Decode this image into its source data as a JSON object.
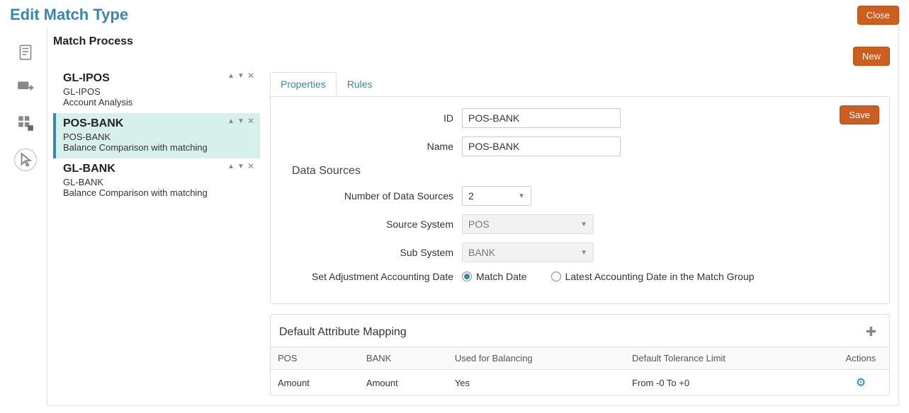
{
  "page_title": "Edit Match Type",
  "close_label": "Close",
  "section_title": "Match Process",
  "new_label": "New",
  "save_label": "Save",
  "items": [
    {
      "title": "GL-IPOS",
      "sub1": "GL-IPOS",
      "sub2": "Account Analysis"
    },
    {
      "title": "POS-BANK",
      "sub1": "POS-BANK",
      "sub2": "Balance Comparison with matching"
    },
    {
      "title": "GL-BANK",
      "sub1": "GL-BANK",
      "sub2": "Balance Comparison with matching"
    }
  ],
  "tabs": {
    "properties": "Properties",
    "rules": "Rules"
  },
  "form": {
    "id_label": "ID",
    "id_value": "POS-BANK",
    "name_label": "Name",
    "name_value": "POS-BANK",
    "ds_header": "Data Sources",
    "num_ds_label": "Number of Data Sources",
    "num_ds_value": "2",
    "source_sys_label": "Source System",
    "source_sys_value": "POS",
    "sub_sys_label": "Sub System",
    "sub_sys_value": "BANK",
    "adj_date_label": "Set Adjustment Accounting Date",
    "radio_match_date": "Match Date",
    "radio_latest": "Latest Accounting Date in the Match Group"
  },
  "mapping": {
    "header": "Default Attribute Mapping",
    "columns": {
      "c1": "POS",
      "c2": "BANK",
      "c3": "Used for Balancing",
      "c4": "Default Tolerance Limit",
      "c5": "Actions"
    },
    "rows": [
      {
        "c1": "Amount",
        "c2": "Amount",
        "c3": "Yes",
        "c4": "From -0 To +0"
      }
    ]
  }
}
